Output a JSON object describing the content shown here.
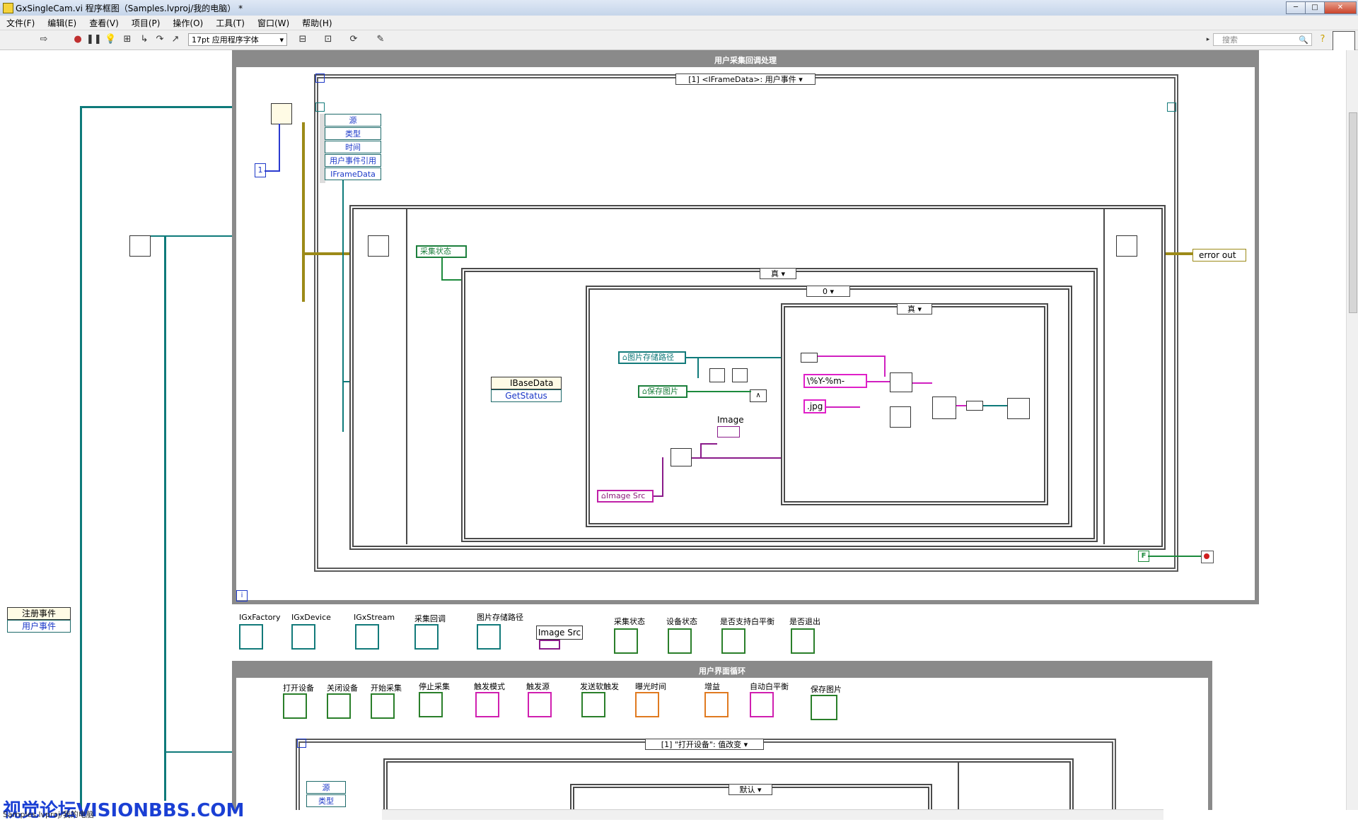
{
  "window": {
    "title": "GxSingleCam.vi 程序框图（Samples.lvproj/我的电脑） *"
  },
  "menu": [
    "文件(F)",
    "编辑(E)",
    "查看(V)",
    "项目(P)",
    "操作(O)",
    "工具(T)",
    "窗口(W)",
    "帮助(H)"
  ],
  "toolbar": {
    "font": "17pt 应用程序字体",
    "search_placeholder": "搜索"
  },
  "diagram": {
    "loop1_title": "用户采集回调处理",
    "event_selector": "[1] <IFrameData>: 用户事件",
    "event_terms": [
      "源",
      "类型",
      "时间",
      "用户事件引用",
      "IFrameData"
    ],
    "const_one": "1",
    "local_collect_state": "采集状态",
    "case_true_1": "真",
    "case_zero": "0",
    "case_true_2": "真",
    "local_img_path": "图片存储路径",
    "local_save_img": "保存图片",
    "str_date": "\\%Y-%m-",
    "str_jpg": ".jpg",
    "invoke_class": "IBaseData",
    "invoke_method": "GetStatus",
    "image_label": "Image",
    "local_image_src": "Image Src",
    "error_out": "error out",
    "false_const": "F",
    "register_event": "注册事件",
    "user_event": "用户事件",
    "info_glyph": "i",
    "loop2_title": "用户界面循环",
    "event_selector_2": "[1] \"打开设备\": 值改变",
    "event_terms_2": [
      "源",
      "类型"
    ],
    "case_default": "默认"
  },
  "terminals_row1": [
    "IGxFactory",
    "IGxDevice",
    "IGxStream",
    "采集回调",
    "图片存储路径",
    "Image Src",
    "采集状态",
    "设备状态",
    "是否支持白平衡",
    "是否退出"
  ],
  "terminals_row2": [
    "打开设备",
    "关闭设备",
    "开始采集",
    "停止采集",
    "触发模式",
    "触发源",
    "发送软触发",
    "曝光时间",
    "增益",
    "自动白平衡",
    "保存图片"
  ],
  "watermark": "视觉论坛VISIONBBS.COM",
  "status_text": "Samples.lvproj/我的电脑"
}
